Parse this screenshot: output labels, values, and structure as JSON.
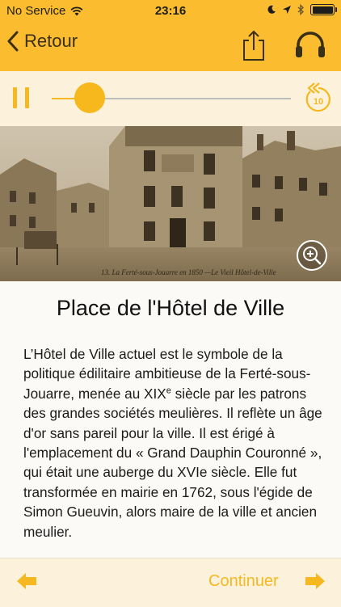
{
  "status_bar": {
    "carrier": "No Service",
    "time": "23:16"
  },
  "nav": {
    "back_label": "Retour"
  },
  "player": {
    "progress": 0.16,
    "replay_seconds": "10"
  },
  "photo": {
    "caption": "13. La Ferté-sous-Jouarre en 1850 —Le Vieil Hôtel-de-Ville"
  },
  "article": {
    "title": "Place de l'Hôtel de Ville",
    "body_part1": "L’Hôtel de Ville actuel est le symbole de la politique édilitaire ambitieuse de la Ferté-sous-Jouarre, menée au XIX",
    "body_sup": "e",
    "body_part2": " siècle par les patrons des grandes sociétés meulières. Il reflète un âge d'or sans pareil pour la ville. Il est érigé à l'emplacement du « Grand Dauphin Couronné », qui était une auberge du XVIe siècle. Elle fut transformée en mairie en 1762, sous l'égide de Simon Gueuvin, alors maire de la ville et ancien meulier."
  },
  "footer": {
    "continue_label": "Continuer"
  },
  "colors": {
    "accent": "#fbbd2f",
    "accent_dark": "#f5b820",
    "player_bg": "#fcf2dc"
  }
}
